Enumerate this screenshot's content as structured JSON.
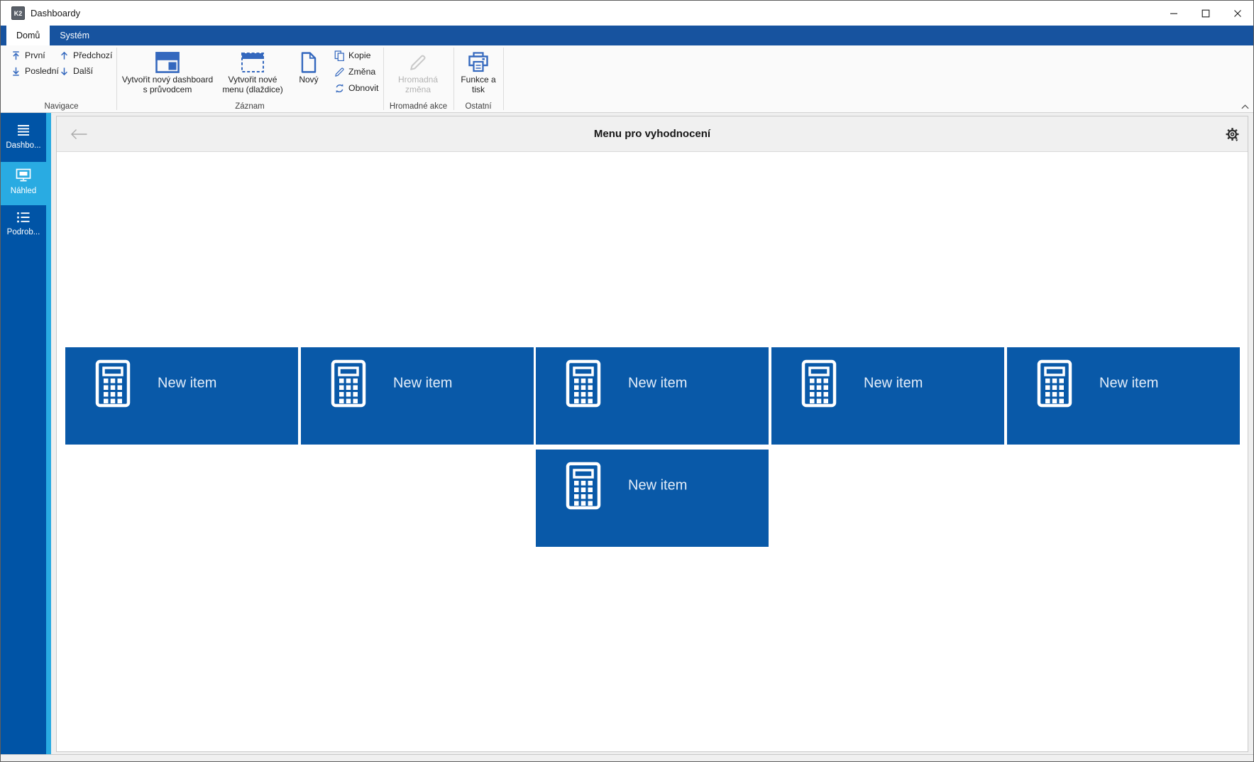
{
  "window": {
    "title": "Dashboardy",
    "app_badge": "K2"
  },
  "tabs": [
    {
      "label": "Domů",
      "active": true
    },
    {
      "label": "Systém",
      "active": false
    }
  ],
  "ribbon": {
    "groups": [
      {
        "caption": "Navigace",
        "small_buttons": [
          {
            "label": "První",
            "icon": "arrow-up-to-bar"
          },
          {
            "label": "Poslední",
            "icon": "arrow-down-to-bar"
          },
          {
            "label": "Předchozí",
            "icon": "arrow-up"
          },
          {
            "label": "Další",
            "icon": "arrow-down"
          }
        ]
      },
      {
        "caption": "Záznam",
        "big_buttons": [
          {
            "line1": "Vytvořit nový dashboard",
            "line2": "s průvodcem",
            "icon": "dashboard"
          },
          {
            "line1": "Vytvořit nové",
            "line2": "menu (dlaždice)",
            "icon": "tiles-dashed"
          },
          {
            "line1": "Nový",
            "icon": "new-document"
          }
        ],
        "small_buttons": [
          {
            "label": "Kopie",
            "icon": "copy"
          },
          {
            "label": "Změna",
            "icon": "pencil"
          },
          {
            "label": "Obnovit",
            "icon": "refresh"
          }
        ]
      },
      {
        "caption": "Hromadné akce",
        "big_buttons": [
          {
            "line1": "Hromadná",
            "line2": "změna",
            "icon": "pencil",
            "disabled": true
          }
        ]
      },
      {
        "caption": "Ostatní",
        "big_buttons": [
          {
            "line1": "Funkce a",
            "line2": "tisk",
            "icon": "printer"
          }
        ]
      }
    ],
    "collapse_icon": "chevron-up"
  },
  "sidebar": {
    "items": [
      {
        "label": "Dashbo...",
        "icon": "menu-lines",
        "active": false
      },
      {
        "label": "Náhled",
        "icon": "monitor",
        "active": true
      },
      {
        "label": "Podrob...",
        "icon": "detail-list",
        "active": false
      }
    ]
  },
  "content": {
    "header": {
      "back_icon": "back-arrow",
      "title": "Menu pro vyhodnocení",
      "settings_icon": "gear"
    },
    "tiles": [
      {
        "label": "New item",
        "icon": "calculator"
      },
      {
        "label": "New item",
        "icon": "calculator"
      },
      {
        "label": "New item",
        "icon": "calculator"
      },
      {
        "label": "New item",
        "icon": "calculator"
      },
      {
        "label": "New item",
        "icon": "calculator"
      },
      {
        "label": "New item",
        "icon": "calculator"
      }
    ]
  },
  "colors": {
    "sidebar_blue": "#0054A6",
    "accent_light_blue": "#29ABE2",
    "tile_blue": "#0959A8",
    "tab_bar_blue": "#17539F",
    "ribbon_icon_blue": "#3468BE",
    "disabled_gray": "#B3B3B3"
  }
}
